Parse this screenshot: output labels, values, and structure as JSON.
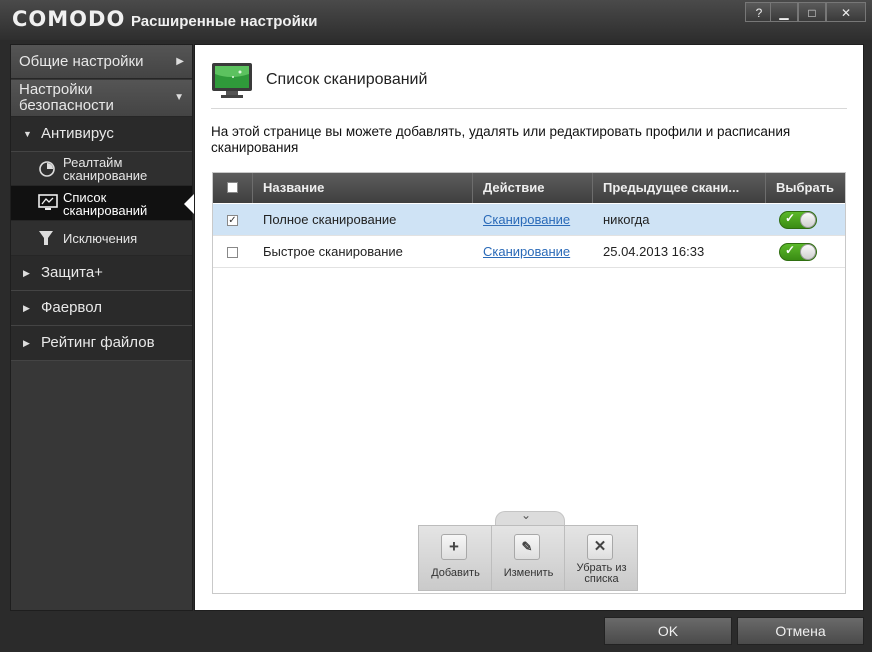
{
  "window": {
    "logo": "COMODO",
    "title": "Расширенные настройки",
    "controls": {
      "help": "?",
      "minimize": "▁",
      "maximize": "□",
      "close": "✕"
    }
  },
  "sidebar": {
    "general": "Общие настройки",
    "security": "Настройки безопасности",
    "antivirus": "Антивирус",
    "antivirus_items": [
      {
        "label": "Реалтайм сканирование",
        "icon": "realtime-scan-icon"
      },
      {
        "label": "Список сканирований",
        "icon": "monitor-scan-icon"
      },
      {
        "label": "Исключения",
        "icon": "filter-icon"
      }
    ],
    "sections": [
      "Защита+",
      "Фаервол",
      "Рейтинг файлов"
    ]
  },
  "main": {
    "title": "Список сканирований",
    "description": "На этой странице вы можете добавлять, удалять или редактировать профили и расписания сканирования",
    "columns": [
      "Название",
      "Действие",
      "Предыдущее скани...",
      "Выбрать"
    ],
    "rows": [
      {
        "checked": true,
        "name": "Полное сканирование",
        "action": "Сканирование",
        "previous": "никогда",
        "enabled": true
      },
      {
        "checked": false,
        "name": "Быстрое сканирование",
        "action": "Сканирование",
        "previous": "25.04.2013 16:33",
        "enabled": true
      }
    ],
    "toolbar": {
      "add": "Добавить",
      "edit": "Изменить",
      "remove": "Убрать из списка"
    }
  },
  "footer": {
    "ok": "OK",
    "cancel": "Отмена"
  }
}
